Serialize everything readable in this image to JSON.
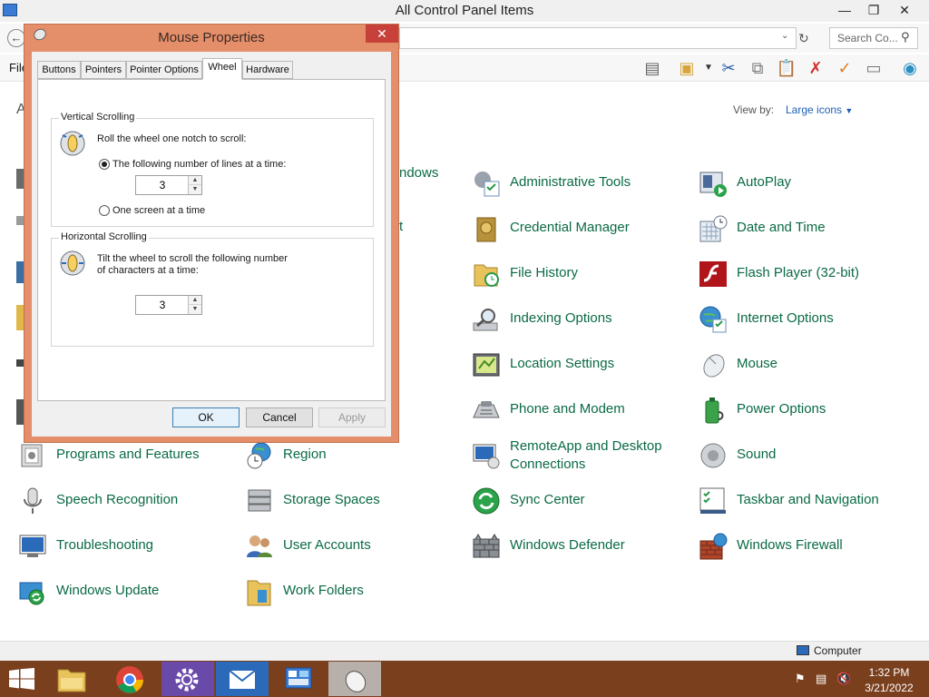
{
  "control_panel": {
    "title": "All Control Panel Items",
    "menu_file": "File",
    "heading_letter": "A",
    "search_placeholder": "Search Co...",
    "view_by_label": "View by:",
    "view_by_value": "Large icons",
    "status_computer": "Computer",
    "partial_labels": {
      "windows": "ndows",
      "t": "t"
    },
    "items": [
      {
        "label": "Administrative Tools",
        "icon": "admin-tools-icon"
      },
      {
        "label": "AutoPlay",
        "icon": "autoplay-icon"
      },
      {
        "label": "Credential Manager",
        "icon": "credential-manager-icon"
      },
      {
        "label": "Date and Time",
        "icon": "date-time-icon"
      },
      {
        "label": "File History",
        "icon": "file-history-icon"
      },
      {
        "label": "Flash Player (32-bit)",
        "icon": "flash-player-icon"
      },
      {
        "label": "Indexing Options",
        "icon": "indexing-options-icon"
      },
      {
        "label": "Internet Options",
        "icon": "internet-options-icon"
      },
      {
        "label": "Location Settings",
        "icon": "location-settings-icon"
      },
      {
        "label": "Mouse",
        "icon": "mouse-icon"
      },
      {
        "label": "Phone and Modem",
        "icon": "phone-modem-icon"
      },
      {
        "label": "Power Options",
        "icon": "power-options-icon"
      },
      {
        "label": "Programs and Features",
        "icon": "programs-features-icon"
      },
      {
        "label": "Region",
        "icon": "region-icon"
      },
      {
        "label": "RemoteApp and Desktop Connections",
        "icon": "remoteapp-icon"
      },
      {
        "label": "Sound",
        "icon": "sound-icon"
      },
      {
        "label": "Speech Recognition",
        "icon": "speech-recognition-icon"
      },
      {
        "label": "Storage Spaces",
        "icon": "storage-spaces-icon"
      },
      {
        "label": "Sync Center",
        "icon": "sync-center-icon"
      },
      {
        "label": "Taskbar and Navigation",
        "icon": "taskbar-navigation-icon"
      },
      {
        "label": "Troubleshooting",
        "icon": "troubleshooting-icon"
      },
      {
        "label": "User Accounts",
        "icon": "user-accounts-icon"
      },
      {
        "label": "Windows Defender",
        "icon": "windows-defender-icon"
      },
      {
        "label": "Windows Firewall",
        "icon": "windows-firewall-icon"
      },
      {
        "label": "Windows Update",
        "icon": "windows-update-icon"
      },
      {
        "label": "Work Folders",
        "icon": "work-folders-icon"
      }
    ]
  },
  "dialog": {
    "title": "Mouse Properties",
    "tabs": [
      "Buttons",
      "Pointers",
      "Pointer Options",
      "Wheel",
      "Hardware"
    ],
    "active_tab": "Wheel",
    "vertical": {
      "title": "Vertical Scrolling",
      "instruction": "Roll the wheel one notch to scroll:",
      "option_lines": "The following number of lines at a time:",
      "option_screen": "One screen at a time",
      "lines_value": "3"
    },
    "horizontal": {
      "title": "Horizontal Scrolling",
      "instruction_line1": "Tilt the wheel to scroll the following number",
      "instruction_line2": "of characters at a time:",
      "chars_value": "3"
    },
    "buttons": {
      "ok": "OK",
      "cancel": "Cancel",
      "apply": "Apply"
    }
  },
  "taskbar": {
    "time": "1:32 PM",
    "date": "3/21/2022"
  },
  "colors": {
    "link_green": "#0a6a44",
    "taskbar": "#7a3f1d",
    "dialog_frame": "#e58e6a",
    "close_red": "#c7403a"
  }
}
